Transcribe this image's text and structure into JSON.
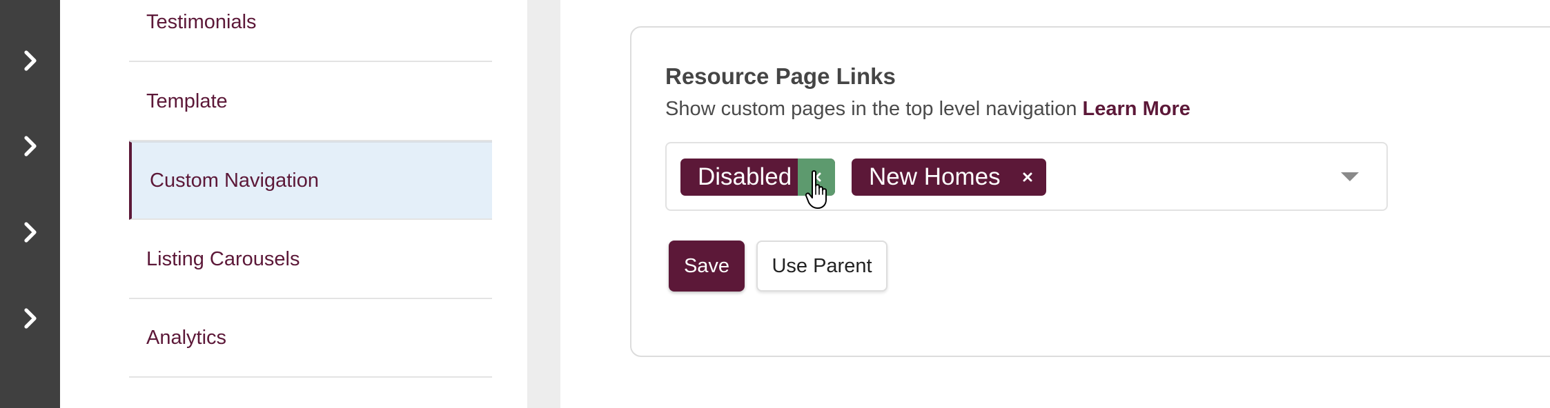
{
  "rail": {
    "items": [
      {
        "icon": "chevron-right-icon"
      },
      {
        "icon": "chevron-right-icon"
      },
      {
        "icon": "chevron-right-icon"
      },
      {
        "icon": "chevron-right-icon"
      }
    ]
  },
  "sidebar": {
    "items": [
      {
        "label": "Testimonials",
        "active": false
      },
      {
        "label": "Template",
        "active": false
      },
      {
        "label": "Custom Navigation",
        "active": true
      },
      {
        "label": "Listing Carousels",
        "active": false
      },
      {
        "label": "Analytics",
        "active": false
      }
    ]
  },
  "card": {
    "title": "Resource Page Links",
    "description": "Show custom pages in the top level navigation",
    "learn_more": "Learn More",
    "tags": [
      {
        "label": "Disabled",
        "remove_hovered": true
      },
      {
        "label": "New Homes",
        "remove_hovered": false
      }
    ],
    "save_label": "Save",
    "use_parent_label": "Use Parent"
  },
  "colors": {
    "brand": "#5c1838",
    "rail": "#404040",
    "active_bg": "#e4eff9",
    "remove_hover": "#5d9a6e"
  }
}
